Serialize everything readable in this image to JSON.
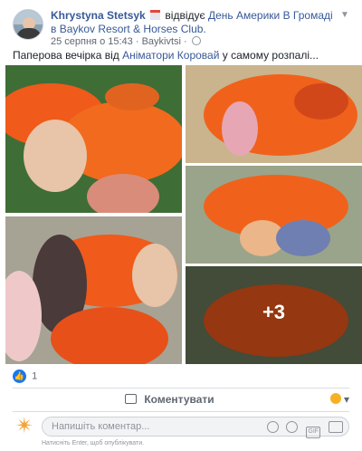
{
  "post": {
    "author": "Khrystyna Stetsyk",
    "action": "відвідує",
    "event_link": "День Америки В Громаді в Baykov Resort & Horses Club.",
    "date": "25 серпня о 15:43",
    "location": "Baykivtsi",
    "text_prefix": "Паперова вечірка від",
    "text_link": "Аніматори Коровай",
    "text_suffix": "у самому розпалі..."
  },
  "photos": {
    "more_count": "+3"
  },
  "reactions": {
    "count": "1"
  },
  "actions": {
    "comment_label": "Коментувати"
  },
  "composer": {
    "placeholder": "Напишіть коментар...",
    "hint": "Натисніть Enter, щоб опублікувати.",
    "gif": "GIF"
  },
  "colors": {
    "link": "#385898",
    "like": "#1877f2",
    "paper": "#f05a1a"
  }
}
